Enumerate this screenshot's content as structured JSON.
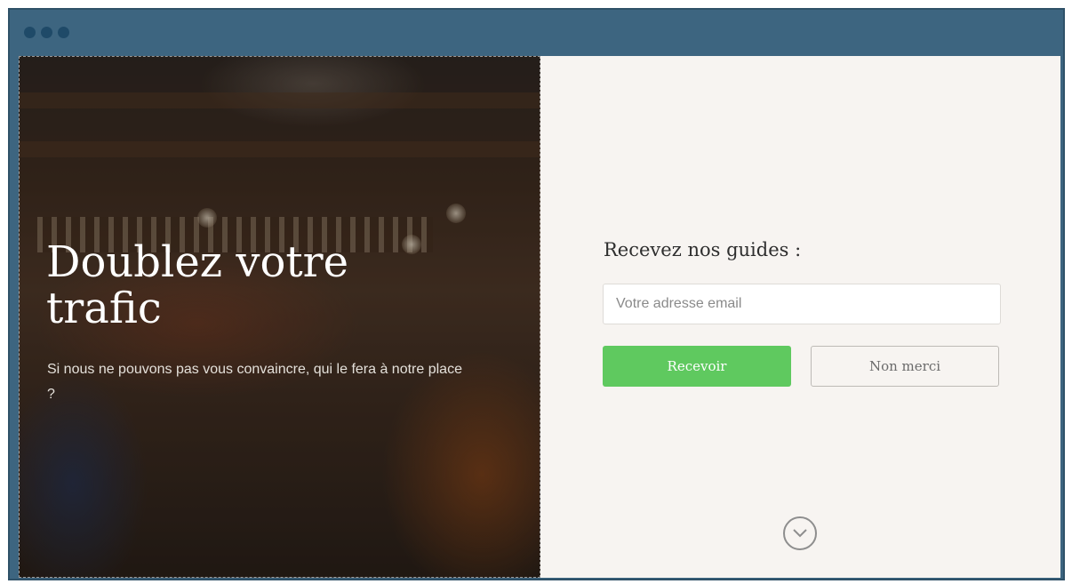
{
  "hero": {
    "title": "Doublez votre trafic",
    "subtitle": "Si nous ne pouvons pas vous convaincre, qui le fera à notre place ?"
  },
  "form": {
    "title": "Recevez nos guides :",
    "email_placeholder": "Votre adresse email",
    "submit_label": "Recevoir",
    "decline_label": "Non merci"
  },
  "icons": {
    "scroll": "chevron-down-icon",
    "window_dots": [
      "window-dot-icon",
      "window-dot-icon",
      "window-dot-icon"
    ]
  },
  "colors": {
    "frame": "#3d6580",
    "accent_green": "#5fc95f",
    "panel_bg": "#f7f4f1"
  }
}
